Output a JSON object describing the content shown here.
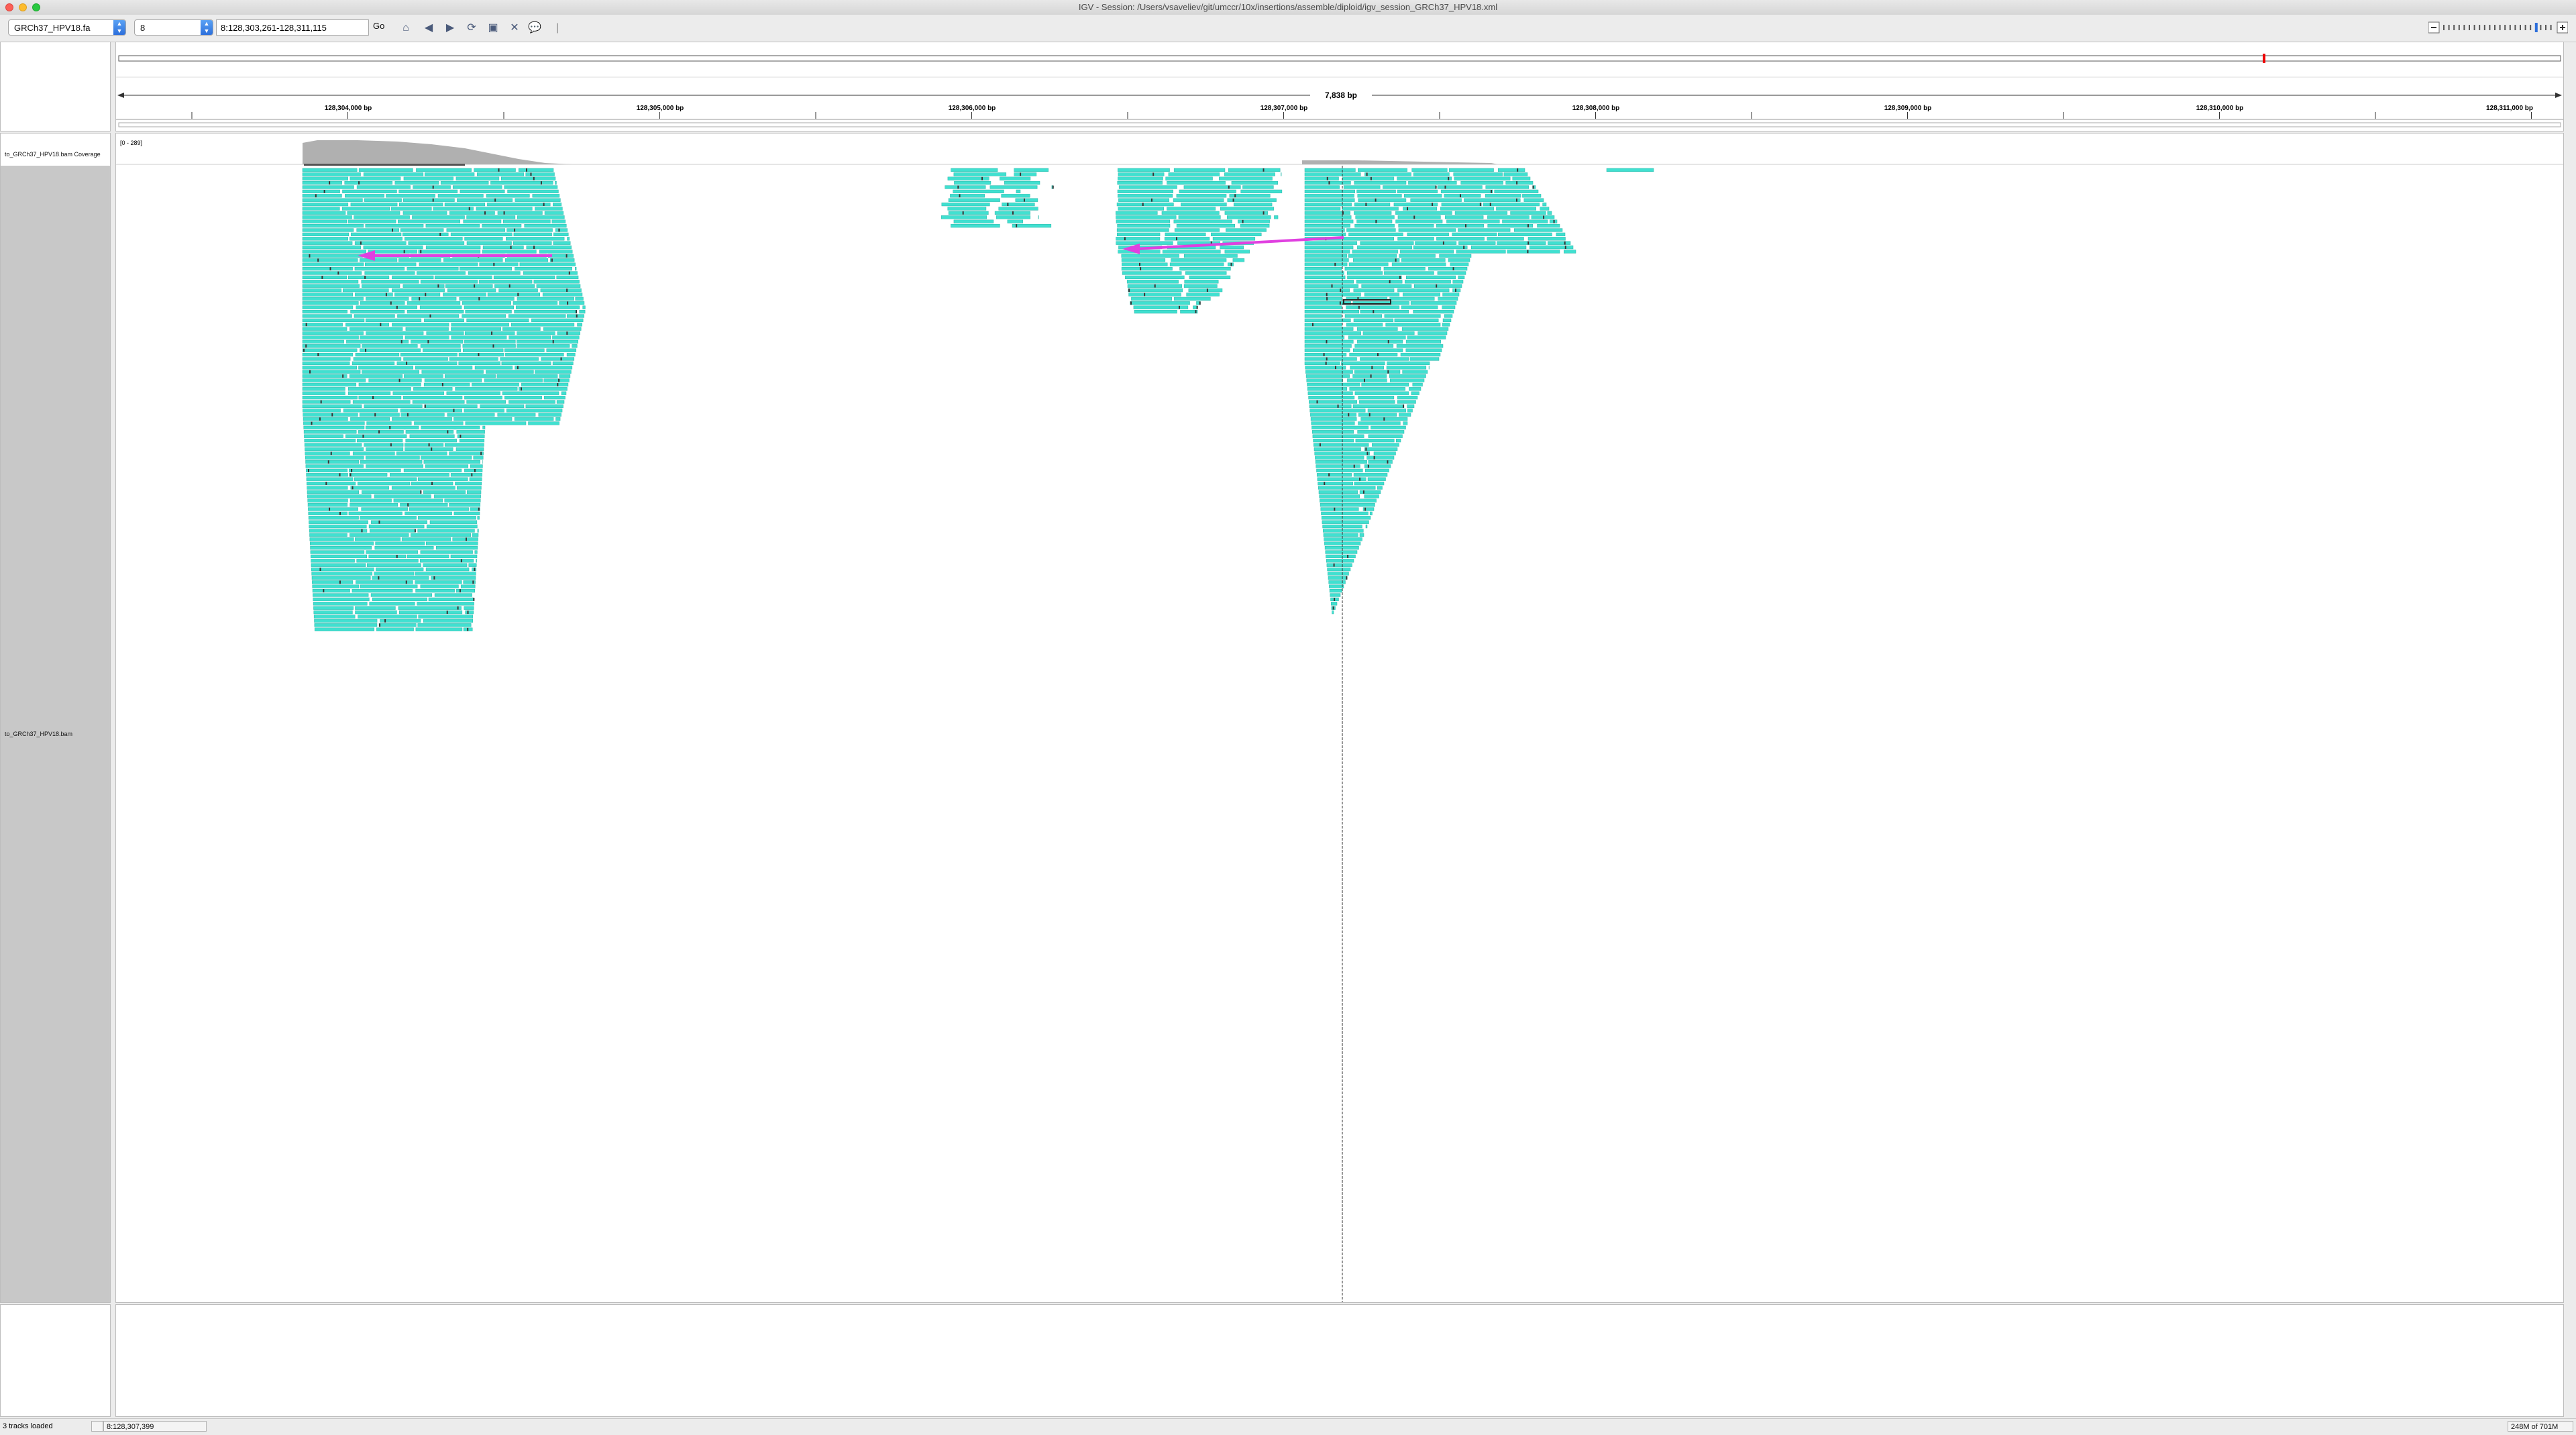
{
  "window": {
    "title": "IGV - Session: /Users/vsaveliev/git/umccr/10x/insertions/assemble/diploid/igv_session_GRCh37_HPV18.xml"
  },
  "toolbar": {
    "genome": "GRCh37_HPV18.fa",
    "chromosome": "8",
    "locus": "8:128,303,261-128,311,115",
    "go_label": "Go",
    "icons": [
      "home-icon",
      "back-icon",
      "forward-icon",
      "refresh-icon",
      "roi-icon",
      "resize-icon",
      "popup-text-icon",
      "divider"
    ]
  },
  "ruler": {
    "span_label": "7,838 bp",
    "ticks": [
      "128,304,000 bp",
      "128,305,000 bp",
      "128,306,000 bp",
      "128,307,000 bp",
      "128,308,000 bp",
      "128,309,000 bp",
      "128,310,000 bp",
      "128,311,000 bp"
    ]
  },
  "tracks": {
    "coverage_label": "to_GRCh37_HPV18.bam Coverage",
    "coverage_range": "[0 - 289]",
    "alignment_label": "to_GRCh37_HPV18.bam"
  },
  "status": {
    "tracks_loaded": "3 tracks loaded",
    "position": "8:128,307,399",
    "memory": "248M of 701M"
  },
  "colors": {
    "read": "#40e0d0",
    "read_outline": "#2cb5a8",
    "coverage": "#b0b0b0",
    "arrow": "#e040e0",
    "mismatch": "#333333"
  }
}
